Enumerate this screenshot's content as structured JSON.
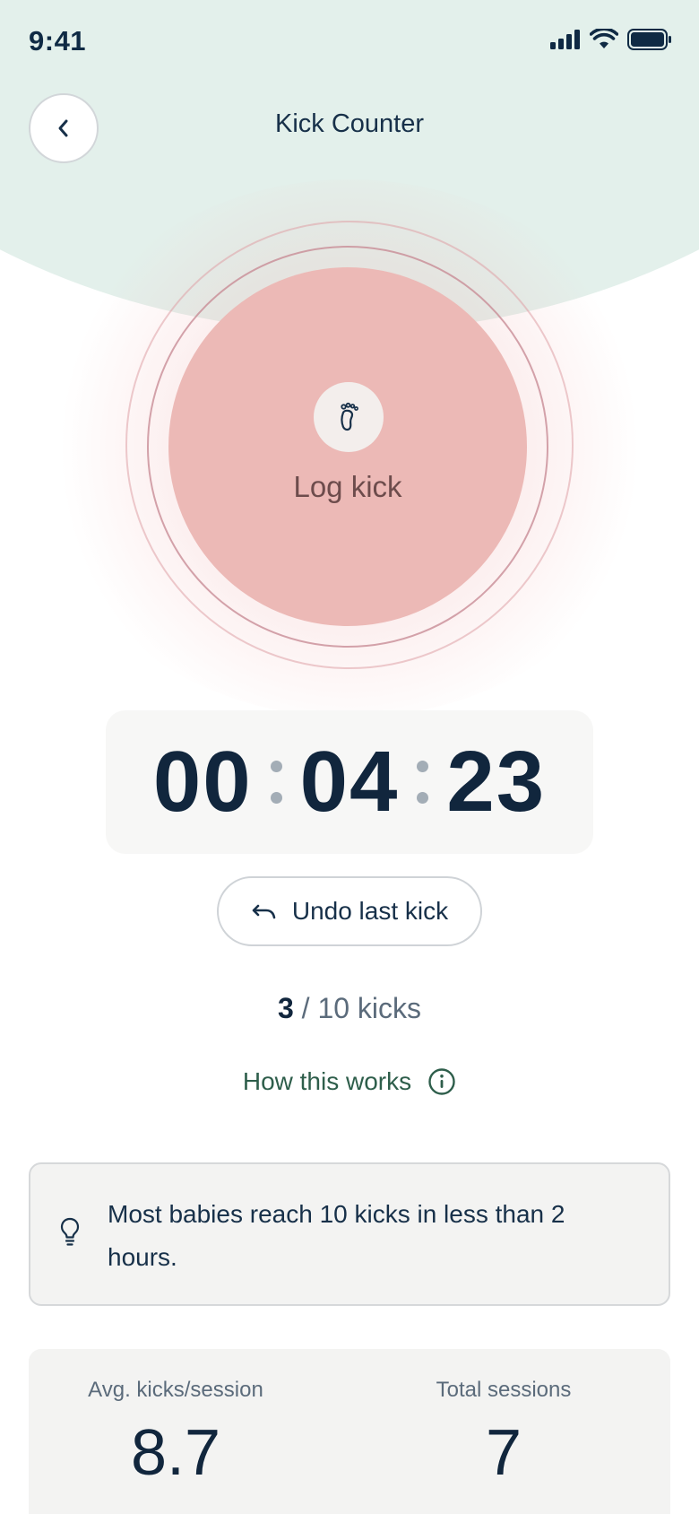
{
  "status_bar": {
    "time": "9:41",
    "icons": [
      "signal-icon",
      "wifi-icon",
      "battery-icon"
    ]
  },
  "header": {
    "title": "Kick Counter",
    "back_icon": "chevron-left-icon"
  },
  "log_button": {
    "label": "Log kick",
    "icon": "foot-icon",
    "color": "#ecb9b6"
  },
  "timer": {
    "hours": "00",
    "minutes": "04",
    "seconds": "23"
  },
  "undo": {
    "label": "Undo last kick",
    "icon": "undo-arrow-icon"
  },
  "progress": {
    "current": "3",
    "rest": " / 10 kicks"
  },
  "help": {
    "label": "How this works",
    "icon": "info-icon"
  },
  "tip": {
    "icon": "lightbulb-icon",
    "text": "Most babies reach 10 kicks in less than 2 hours."
  },
  "stats": {
    "avg_label": "Avg. kicks/session",
    "avg_value": "8.7",
    "total_label": "Total sessions",
    "total_value": "7"
  },
  "colors": {
    "header_bg": "#e3f0eb",
    "accent_green": "#2e5e4b",
    "text_dark": "#11263d"
  }
}
